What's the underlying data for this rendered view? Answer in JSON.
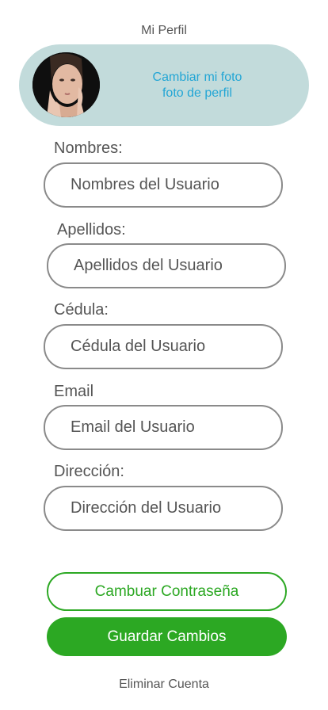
{
  "header": {
    "title": "Mi Perfil"
  },
  "profile": {
    "avatar_icon": "profile-photo",
    "change_photo_line1": "Cambiar mi foto",
    "change_photo_line2": "foto de perfil"
  },
  "form": {
    "names": {
      "label": "Nombres:",
      "placeholder": "Nombres del Usuario"
    },
    "surnames": {
      "label": "Apellidos:",
      "placeholder": "Apellidos del Usuario"
    },
    "id_number": {
      "label": "Cédula:",
      "placeholder": "Cédula del Usuario"
    },
    "email": {
      "label": "Email",
      "placeholder": "Email del Usuario"
    },
    "address": {
      "label": "Dirección:",
      "placeholder": "Dirección del Usuario"
    }
  },
  "actions": {
    "change_password": "Cambuar Contraseña",
    "save": "Guardar Cambios",
    "delete_account": "Eliminar Cuenta"
  },
  "colors": {
    "accent_green": "#2ca823",
    "link_blue": "#23a6d5",
    "card_bg": "#c2dbdb"
  }
}
